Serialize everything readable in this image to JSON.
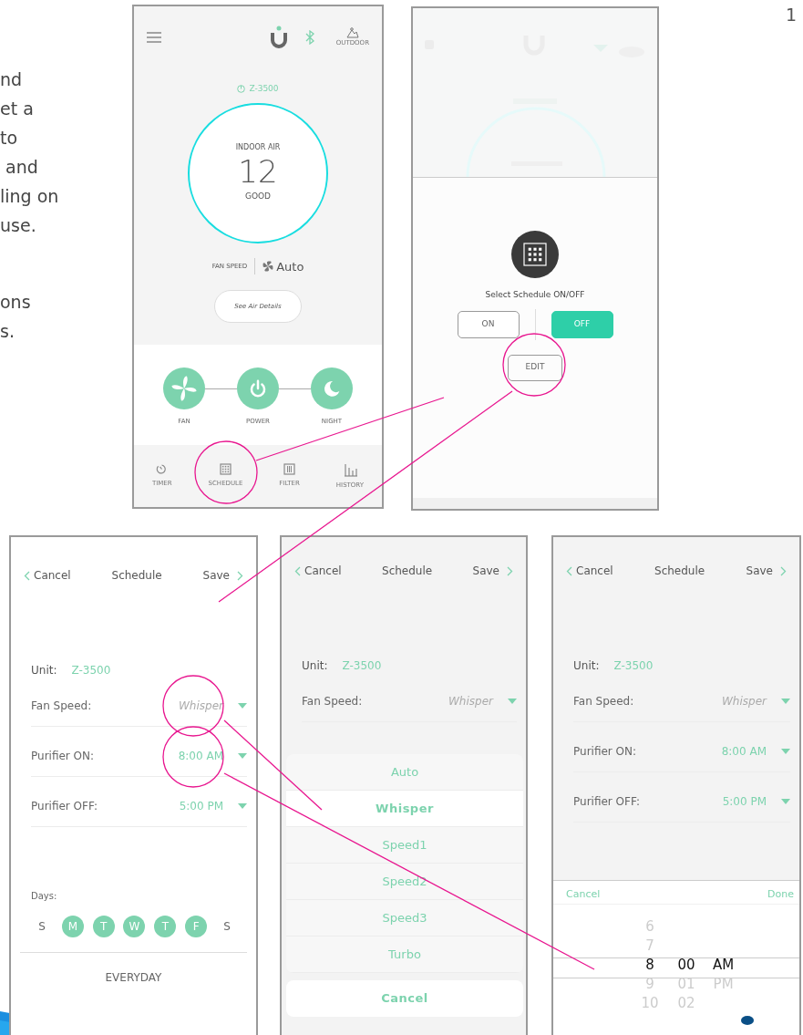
{
  "page_number": "1",
  "body_text": [
    "nd",
    "et a",
    "to",
    " and",
    "ling on",
    "use.",
    "ons",
    "s."
  ],
  "home_screen": {
    "outdoor_label": "OUTDOOR",
    "unit": "Z-3500",
    "gauge_label": "INDOOR AIR",
    "gauge_value": "12",
    "gauge_rating": "GOOD",
    "fan_speed_label": "FAN SPEED",
    "fan_speed_value": "Auto",
    "details_button": "See Air Details",
    "controls": [
      {
        "kind": "fan",
        "label": "FAN"
      },
      {
        "kind": "power",
        "label": "POWER"
      },
      {
        "kind": "night",
        "label": "NIGHT"
      }
    ],
    "tabs": [
      {
        "kind": "timer",
        "label": "TIMER"
      },
      {
        "kind": "schedule",
        "label": "SCHEDULE"
      },
      {
        "kind": "filter",
        "label": "FILTER"
      },
      {
        "kind": "history",
        "label": "HISTORY"
      }
    ]
  },
  "schedule_dialog": {
    "title": "Select Schedule ON/OFF",
    "options": [
      {
        "label": "ON",
        "selected": false
      },
      {
        "label": "OFF",
        "selected": true
      }
    ],
    "edit_button": "EDIT"
  },
  "schedule_screens": [
    {
      "nav": {
        "cancel": "Cancel",
        "title": "Schedule",
        "save": "Save"
      },
      "unit_label": "Unit:",
      "unit": "Z-3500",
      "rows": [
        {
          "label": "Fan Speed:",
          "value": "Whisper",
          "placeholder": true
        },
        {
          "label": "Purifier ON:",
          "value": "8:00 AM",
          "placeholder": false
        },
        {
          "label": "Purifier OFF:",
          "value": "5:00 PM",
          "placeholder": false
        }
      ],
      "days_label": "Days:",
      "days": [
        {
          "label": "S",
          "selected": false
        },
        {
          "label": "M",
          "selected": true
        },
        {
          "label": "T",
          "selected": true
        },
        {
          "label": "W",
          "selected": true
        },
        {
          "label": "T",
          "selected": true
        },
        {
          "label": "F",
          "selected": true
        },
        {
          "label": "S",
          "selected": false
        }
      ],
      "repeat": "EVERYDAY"
    },
    {
      "nav": {
        "cancel": "Cancel",
        "title": "Schedule",
        "save": "Save"
      },
      "unit_label": "Unit:",
      "unit": "Z-3500",
      "rows": [
        {
          "label": "Fan Speed:",
          "value": "Whisper",
          "placeholder": true
        }
      ],
      "fan_speed_sheet": {
        "options": [
          {
            "label": "Auto",
            "selected": false
          },
          {
            "label": "Whisper",
            "selected": true
          },
          {
            "label": "Speed1",
            "selected": false
          },
          {
            "label": "Speed2",
            "selected": false
          },
          {
            "label": "Speed3",
            "selected": false
          },
          {
            "label": "Turbo",
            "selected": false
          }
        ],
        "cancel": "Cancel"
      }
    },
    {
      "nav": {
        "cancel": "Cancel",
        "title": "Schedule",
        "save": "Save"
      },
      "unit_label": "Unit:",
      "unit": "Z-3500",
      "rows": [
        {
          "label": "Fan Speed:",
          "value": "Whisper",
          "placeholder": true
        },
        {
          "label": "Purifier ON:",
          "value": "8:00 AM",
          "placeholder": false
        },
        {
          "label": "Purifier OFF:",
          "value": "5:00 PM",
          "placeholder": false
        }
      ],
      "time_picker": {
        "cancel": "Cancel",
        "done": "Done",
        "columns": [
          [
            {
              "label": "6",
              "selected": false
            },
            {
              "label": "7",
              "selected": false
            },
            {
              "label": "8",
              "selected": true
            },
            {
              "label": "9",
              "selected": false
            },
            {
              "label": "10",
              "selected": false
            }
          ],
          [
            {
              "label": "00",
              "selected": true
            },
            {
              "label": "01",
              "selected": false
            },
            {
              "label": "02",
              "selected": false
            }
          ],
          [
            {
              "label": "AM",
              "selected": true
            },
            {
              "label": "PM",
              "selected": false
            }
          ]
        ]
      }
    }
  ]
}
